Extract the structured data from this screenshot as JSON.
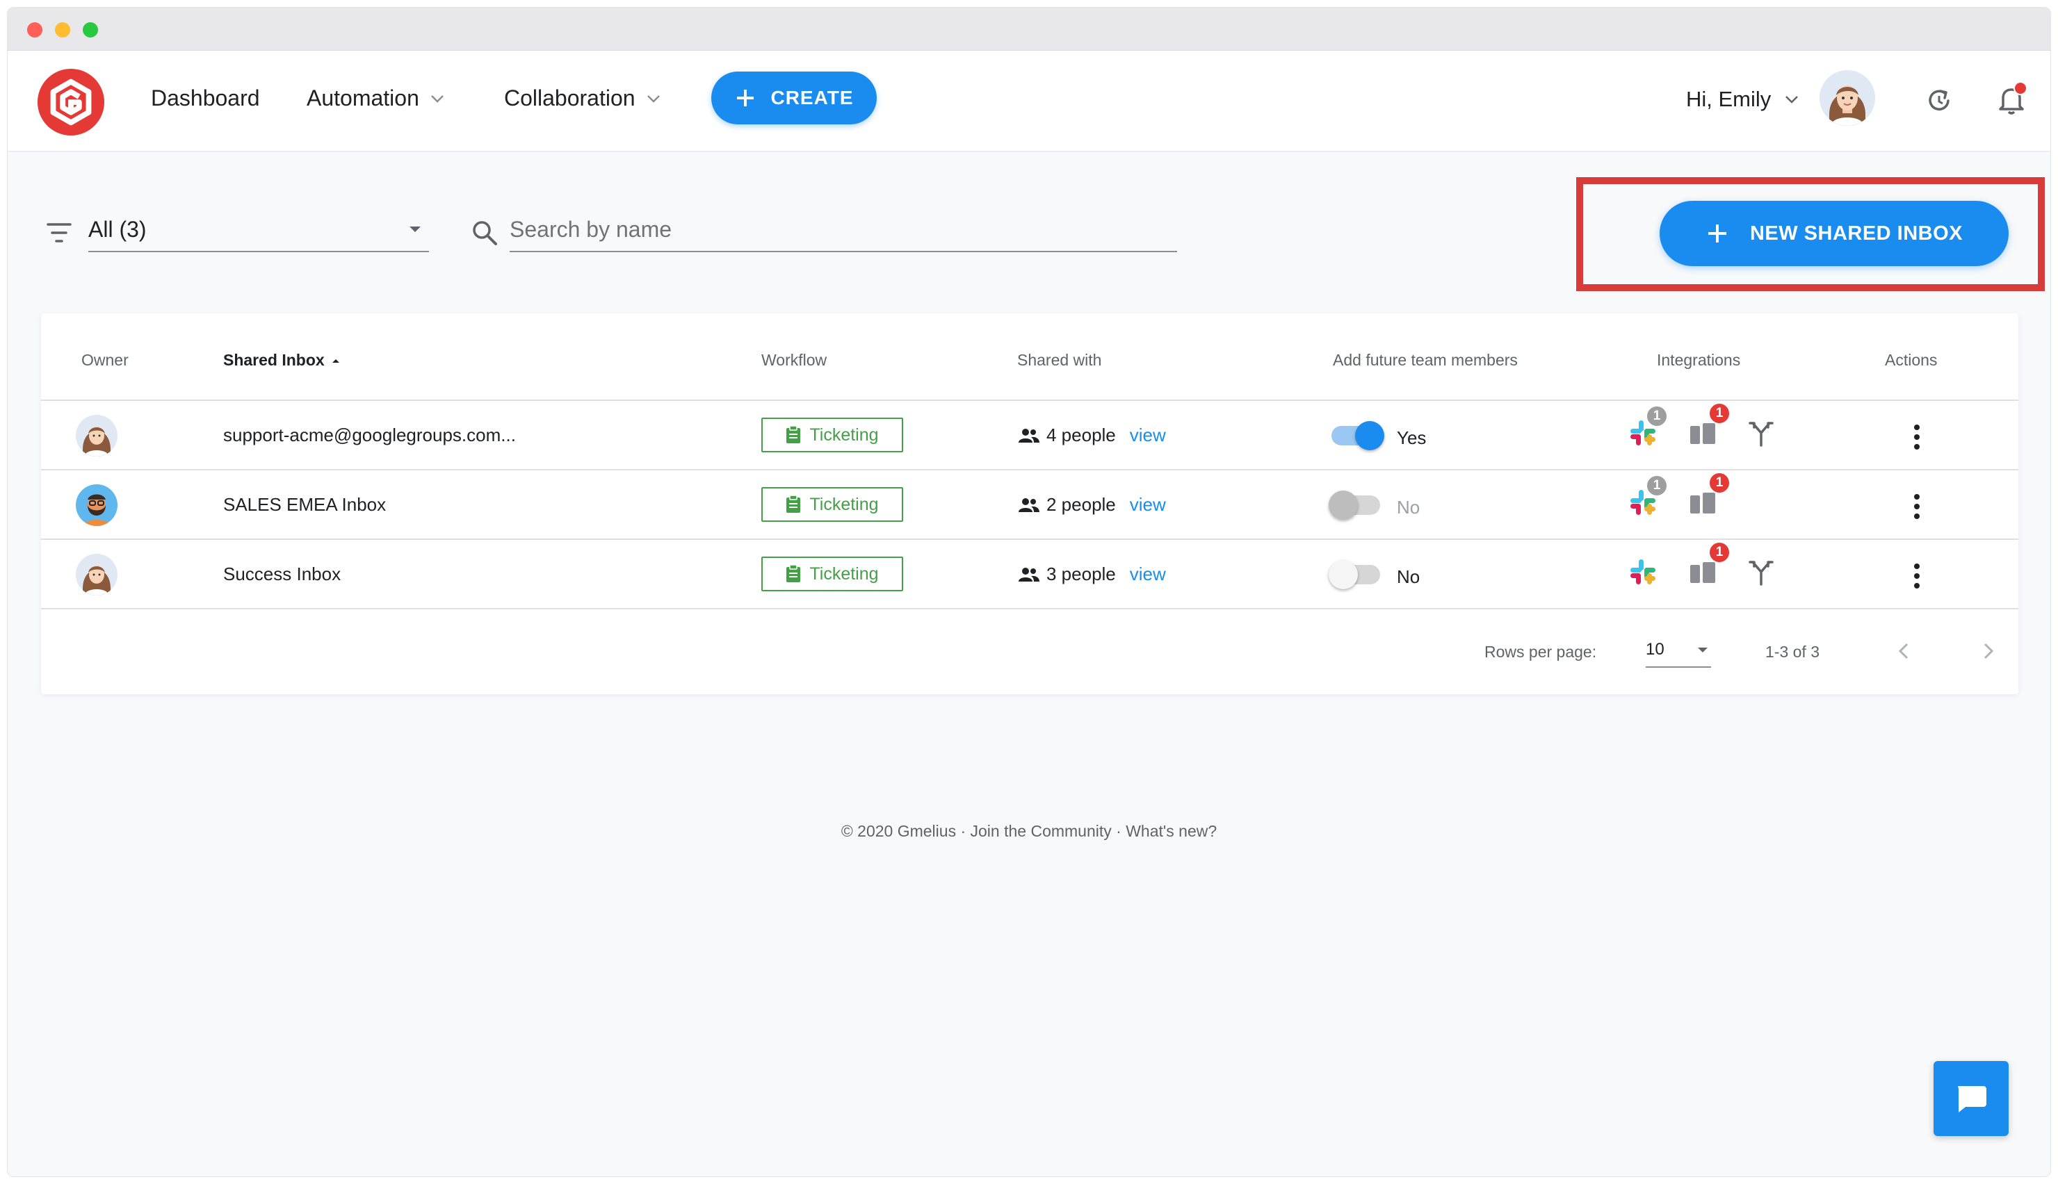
{
  "nav": {
    "dashboard": "Dashboard",
    "automation": "Automation",
    "collaboration": "Collaboration",
    "create": "CREATE",
    "greeting": "Hi, Emily"
  },
  "toolbar": {
    "filter_value": "All (3)",
    "search_placeholder": "Search by name",
    "new_inbox": "NEW SHARED INBOX"
  },
  "table": {
    "headers": {
      "owner": "Owner",
      "shared_inbox": "Shared Inbox",
      "workflow": "Workflow",
      "shared_with": "Shared with",
      "future_members": "Add future team members",
      "integrations": "Integrations",
      "actions": "Actions"
    },
    "rows": [
      {
        "name": "support-acme@googlegroups.com...",
        "workflow": "Ticketing",
        "people": "4 people",
        "view": "view",
        "future": "Yes",
        "slack_count": "1",
        "trello_count": "1"
      },
      {
        "name": "SALES EMEA Inbox",
        "workflow": "Ticketing",
        "people": "2 people",
        "view": "view",
        "future": "No",
        "slack_count": "1",
        "trello_count": "1"
      },
      {
        "name": "Success Inbox",
        "workflow": "Ticketing",
        "people": "3 people",
        "view": "view",
        "future": "No",
        "trello_count": "1"
      }
    ],
    "pagination": {
      "rows_per_page_label": "Rows per page:",
      "rows_per_page": "10",
      "range": "1-3 of 3"
    }
  },
  "footer": {
    "text": "© 2020 Gmelius · Join the Community · What's new?"
  },
  "colors": {
    "accent": "#1a8cf0",
    "ticketing_green": "#43a047",
    "highlight_red": "#d93a3a",
    "badge_red": "#e53935"
  }
}
